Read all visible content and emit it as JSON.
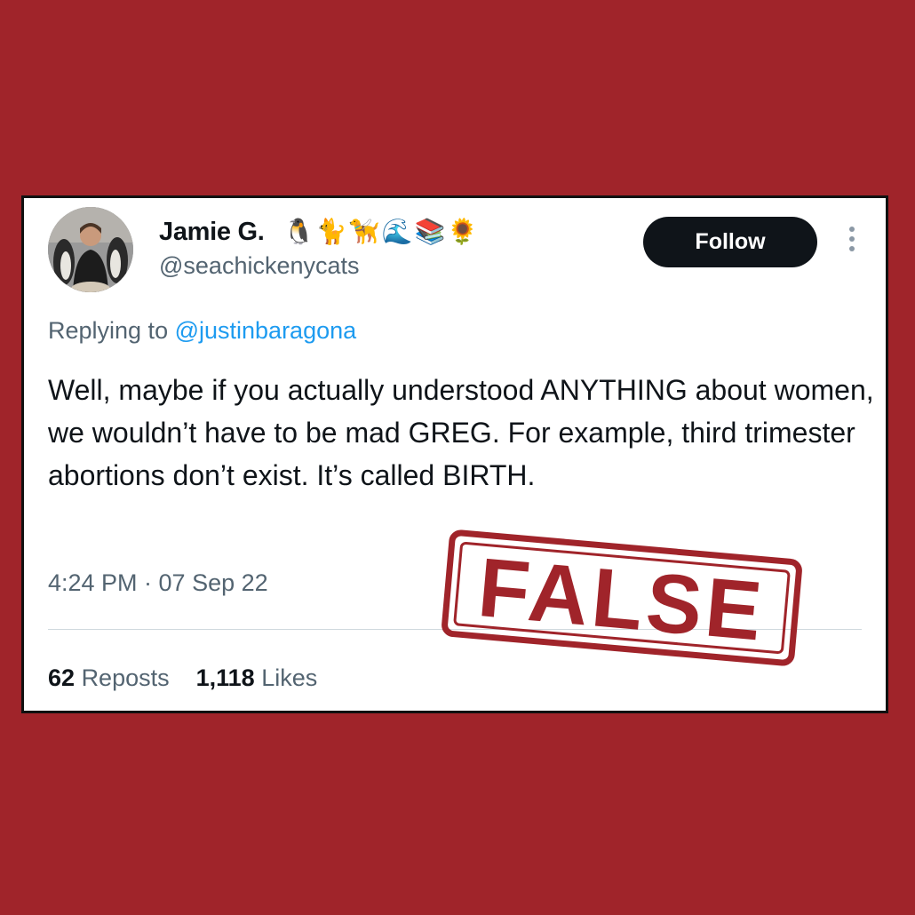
{
  "tweet": {
    "display_name": "Jamie G.",
    "emojis": [
      "🐧",
      "🐈",
      "🦮",
      "🌊",
      "📚",
      "🌻"
    ],
    "handle": "@seachickenycats",
    "follow_label": "Follow",
    "reply_prefix": "Replying to ",
    "reply_mention": "@justinbaragona",
    "text": "Well, maybe if you actually understood ANYTHING about women, we wouldn’t have to be mad GREG. For example, third trimester abortions don’t exist. It’s called BIRTH.",
    "timestamp": "4:24 PM · 07 Sep 22",
    "reposts_count": "62",
    "reposts_label": "Reposts",
    "likes_count": "1,118",
    "likes_label": "Likes"
  },
  "stamp": {
    "label": "FALSE",
    "color": "#a0242a"
  },
  "colors": {
    "background": "#a0242a",
    "card": "#ffffff",
    "text_primary": "#0f1419",
    "text_secondary": "#536471",
    "link": "#1d9bf0"
  },
  "icons": [
    "avatar",
    "more-options-icon"
  ]
}
